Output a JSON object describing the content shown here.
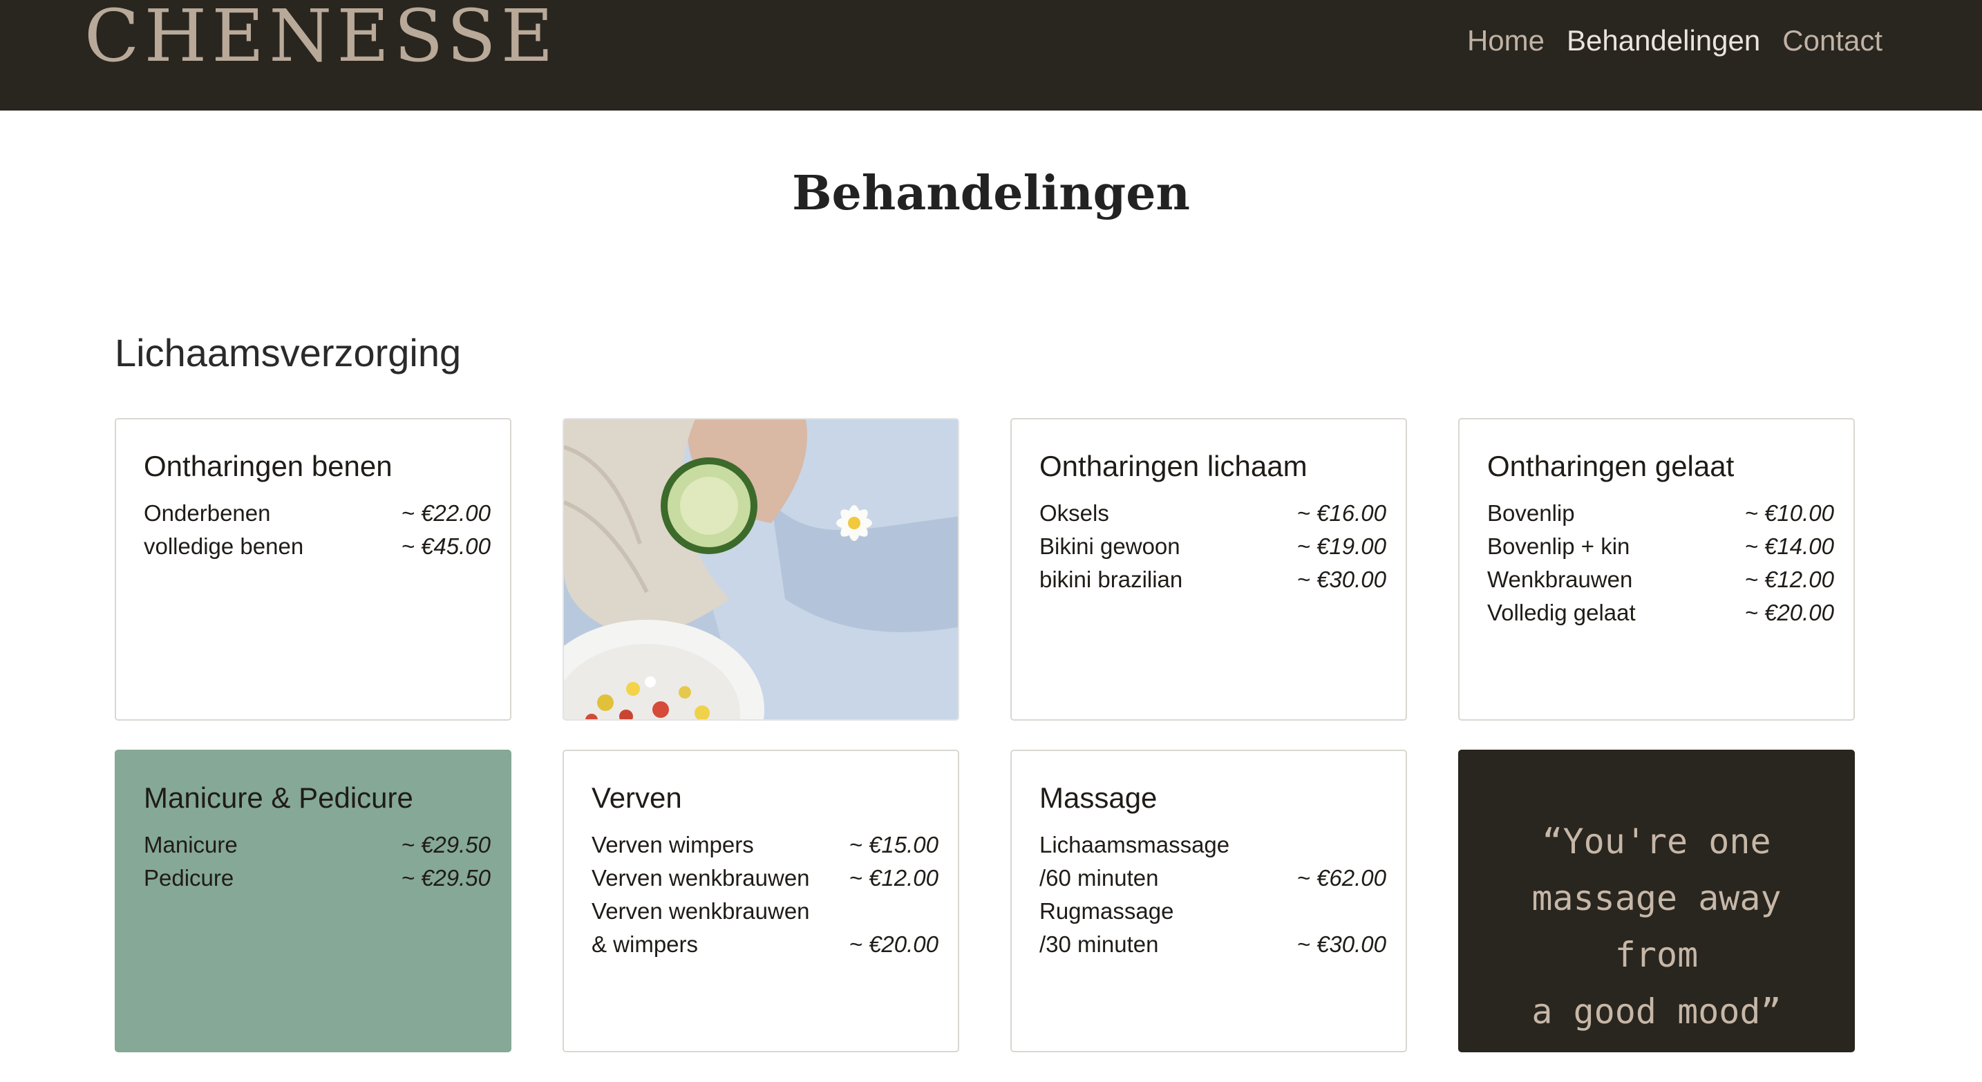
{
  "header": {
    "logo": "CHENESSE",
    "nav": [
      {
        "label": "Home",
        "active": false
      },
      {
        "label": "Behandelingen",
        "active": true
      },
      {
        "label": "Contact",
        "active": false
      }
    ]
  },
  "page_title": "Behandelingen",
  "section_title": "Lichaamsverzorging",
  "cards": {
    "benen": {
      "title": "Ontharingen benen",
      "items": [
        {
          "name": "Onderbenen",
          "price": "~ €22.00"
        },
        {
          "name": "volledige benen",
          "price": "~ €45.00"
        }
      ]
    },
    "lichaam": {
      "title": "Ontharingen lichaam",
      "items": [
        {
          "name": "Oksels",
          "price": "~ €16.00"
        },
        {
          "name": "Bikini gewoon",
          "price": "~ €19.00"
        },
        {
          "name": "bikini brazilian",
          "price": "~ €30.00"
        }
      ]
    },
    "gelaat": {
      "title": "Ontharingen gelaat",
      "items": [
        {
          "name": "Bovenlip",
          "price": "~ €10.00"
        },
        {
          "name": "Bovenlip + kin",
          "price": "~ €14.00"
        },
        {
          "name": "Wenkbrauwen",
          "price": "~ €12.00"
        },
        {
          "name": "Volledig gelaat",
          "price": "~ €20.00"
        }
      ]
    },
    "manicure": {
      "title": "Manicure & Pedicure",
      "items": [
        {
          "name": "Manicure",
          "price": "~ €29.50"
        },
        {
          "name": "Pedicure",
          "price": "~ €29.50"
        }
      ]
    },
    "verven": {
      "title": "Verven",
      "items": [
        {
          "name": "Verven wimpers",
          "price": "~ €15.00"
        },
        {
          "name": "Verven wenkbrauwen",
          "price": "~ €12.00"
        },
        {
          "name": "Verven wenkbrauwen",
          "price": ""
        },
        {
          "name": "& wimpers",
          "price": "~ €20.00"
        }
      ]
    },
    "massage": {
      "title": "Massage",
      "items": [
        {
          "name": "Lichaamsmassage",
          "price": ""
        },
        {
          "name": "/60 minuten",
          "price": "~ €62.00"
        },
        {
          "name": "Rugmassage",
          "price": ""
        },
        {
          "name": "/30 minuten",
          "price": "~ €30.00"
        }
      ]
    }
  },
  "quote": {
    "line1": "“You're one",
    "line2": "massage away from",
    "line3": "a good mood”"
  },
  "colors": {
    "header_bg": "#29251f",
    "logo": "#b8a999",
    "accent_green": "#86a896",
    "quote_text": "#c6b7a7"
  }
}
